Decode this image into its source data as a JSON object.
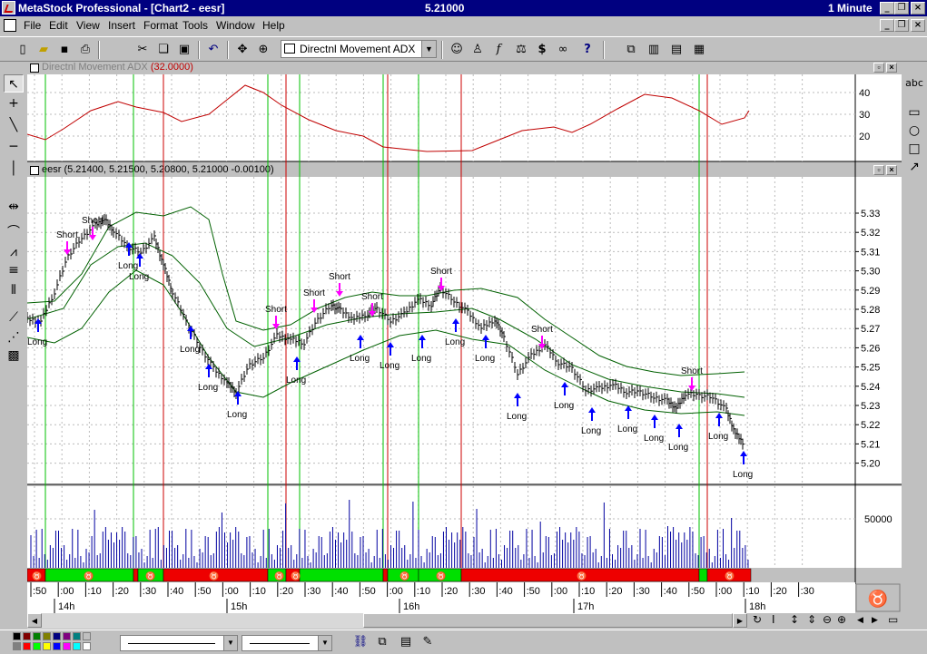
{
  "window": {
    "title": "MetaStock Professional - [Chart2 - eesr]",
    "price": "5.21000",
    "interval": "1 Minute"
  },
  "menu": [
    "File",
    "Edit",
    "View",
    "Insert",
    "Format",
    "Tools",
    "Window",
    "Help"
  ],
  "toolbar": {
    "indicator_value": "Directnl Movement ADX"
  },
  "icons": [
    "new-icon",
    "open-icon",
    "save-icon",
    "print-icon",
    "cut-icon",
    "copy-icon",
    "paste-icon",
    "undo-icon",
    "pan-icon",
    "zoom-icon",
    "indicator-icon",
    "expert-icon",
    "explorer-icon",
    "function-icon",
    "system-tester-icon",
    "dollar-icon",
    "binoculars-icon",
    "help-pointer-icon",
    "cascade-icon",
    "tile-vertical-icon",
    "tile-horizontal-icon",
    "arrange-icon"
  ],
  "adx_pane": {
    "label": "Directnl Movement ADX",
    "value": "(32.0000)",
    "axis_ticks": [
      40,
      30,
      20
    ]
  },
  "price_pane": {
    "label": "eesr (5.21400, 5.21500, 5.20800, 5.21000 -0.00100)",
    "axis_ticks": [
      "5.33",
      "5.32",
      "5.31",
      "5.30",
      "5.29",
      "5.28",
      "5.27",
      "5.26",
      "5.25",
      "5.24",
      "5.23",
      "5.22",
      "5.21",
      "5.20"
    ]
  },
  "volume_pane": {
    "axis_ticks": [
      "50000"
    ]
  },
  "time_axis": {
    "minor_labels": [
      ":50",
      ":00",
      ":10",
      ":20",
      ":30",
      ":40",
      ":50",
      ":00",
      ":10",
      ":20",
      ":30",
      ":40",
      ":50",
      ":00",
      ":10",
      ":20",
      ":30",
      ":40",
      ":50",
      ":00",
      ":10",
      ":20",
      ":30",
      ":40",
      ":50",
      ":00",
      ":10",
      ":20",
      ":30"
    ],
    "hour_labels": [
      "14h",
      "15h",
      "16h",
      "17h",
      "18h"
    ]
  },
  "chart_data": {
    "type": "line",
    "title": "",
    "y_range": [
      5.195,
      5.34
    ],
    "signals": [
      {
        "label": "Short",
        "kind": "short"
      },
      {
        "label": "Short",
        "kind": "short"
      },
      {
        "label": "Long",
        "kind": "long"
      },
      {
        "label": "Long",
        "kind": "long"
      },
      {
        "label": "Long",
        "kind": "long"
      },
      {
        "label": "Long",
        "kind": "long"
      },
      {
        "label": "Long",
        "kind": "long"
      },
      {
        "label": "Long",
        "kind": "long"
      },
      {
        "label": "Short",
        "kind": "short"
      },
      {
        "label": "Long",
        "kind": "long"
      },
      {
        "label": "Short",
        "kind": "short"
      },
      {
        "label": "Short",
        "kind": "short"
      },
      {
        "label": "Short",
        "kind": "short"
      },
      {
        "label": "Long",
        "kind": "long"
      },
      {
        "label": "Long",
        "kind": "long"
      },
      {
        "label": "Long",
        "kind": "long"
      },
      {
        "label": "Short",
        "kind": "short"
      },
      {
        "label": "Long",
        "kind": "long"
      },
      {
        "label": "Long",
        "kind": "long"
      },
      {
        "label": "Short",
        "kind": "short"
      },
      {
        "label": "Long",
        "kind": "long"
      },
      {
        "label": "Long",
        "kind": "long"
      },
      {
        "label": "Long",
        "kind": "long"
      },
      {
        "label": "Long",
        "kind": "long"
      },
      {
        "label": "Long",
        "kind": "long"
      },
      {
        "label": "Long",
        "kind": "long"
      },
      {
        "label": "Short",
        "kind": "short"
      },
      {
        "label": "Long",
        "kind": "long"
      },
      {
        "label": "Long",
        "kind": "long"
      }
    ],
    "colors": {
      "adx_line": "#c00000",
      "bands": "#006000",
      "buy_marker": "#00c000",
      "sell_marker": "#cc0000",
      "long_arrow": "#0000ff",
      "short_arrow": "#ff00ff",
      "volume": "#0000a0",
      "ribbon_green": "#00e000",
      "ribbon_red": "#ee0000"
    }
  }
}
